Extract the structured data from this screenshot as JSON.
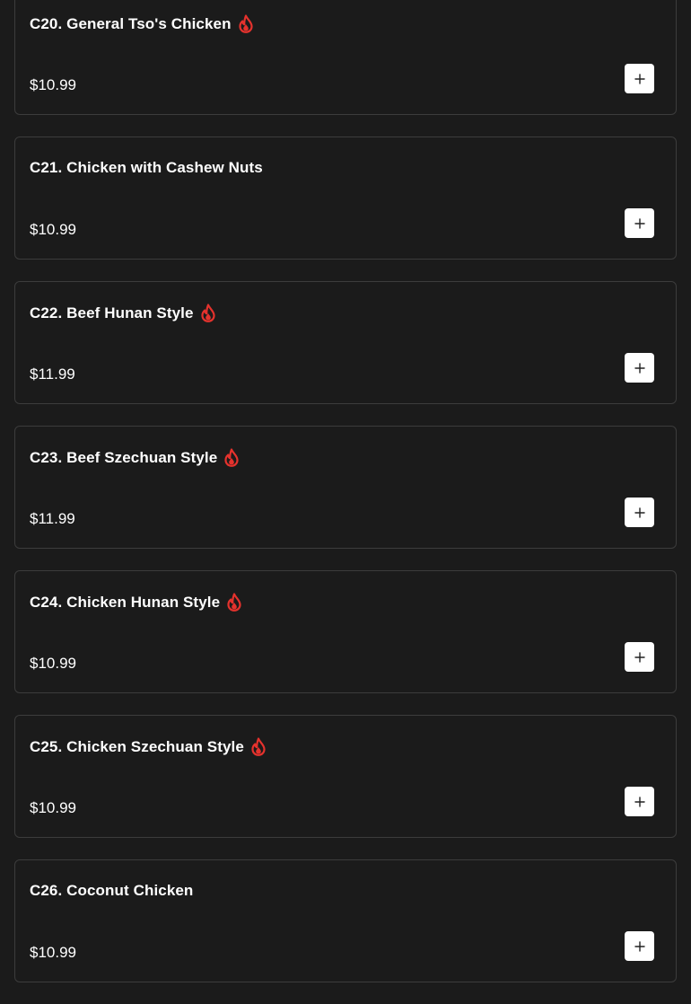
{
  "menu": {
    "items": [
      {
        "title": "C20. General Tso's Chicken",
        "spicy": true,
        "price": "$10.99"
      },
      {
        "title": "C21. Chicken with Cashew Nuts",
        "spicy": false,
        "price": "$10.99"
      },
      {
        "title": "C22. Beef Hunan Style",
        "spicy": true,
        "price": "$11.99"
      },
      {
        "title": "C23. Beef Szechuan Style",
        "spicy": true,
        "price": "$11.99"
      },
      {
        "title": "C24. Chicken Hunan Style",
        "spicy": true,
        "price": "$10.99"
      },
      {
        "title": "C25. Chicken Szechuan Style",
        "spicy": true,
        "price": "$10.99"
      },
      {
        "title": "C26. Coconut Chicken",
        "spicy": false,
        "price": "$10.99"
      }
    ]
  },
  "icons": {
    "spicy": "spicy-flame-icon",
    "add": "plus-icon"
  },
  "colors": {
    "background": "#1b1b1b",
    "card_border": "#3c3c3c",
    "spicy": "#e5322d",
    "add_button": "#ffffff"
  }
}
